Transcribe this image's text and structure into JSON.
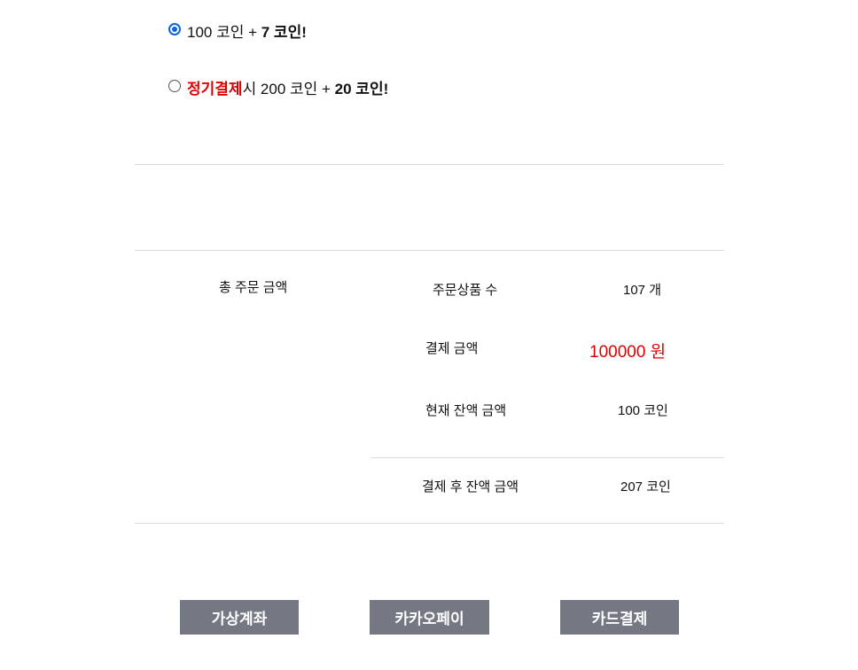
{
  "options": [
    {
      "selected": true,
      "prefix_highlight": "",
      "text": "100 코인 + ",
      "bonus": "7 코인!"
    },
    {
      "selected": false,
      "prefix_highlight": "정기결제",
      "text": "시 200 코인 + ",
      "bonus": "20 코인!"
    }
  ],
  "summary": {
    "section_label": "총 주문 금액",
    "order_count_label": "주문상품 수",
    "order_count_value": "107 개",
    "payment_label": "결제 금액",
    "payment_value": "100000 원",
    "balance_label": "현재 잔액 금액",
    "balance_value": "100 코인",
    "after_label": "결제 후 잔액 금액",
    "after_value": "207 코인"
  },
  "buttons": {
    "virtual_account": "가상계좌",
    "kakaopay": "카카오페이",
    "card": "카드결제"
  },
  "colors": {
    "accent_red": "#e00000",
    "radio_blue": "#0a66d6",
    "button_gray": "#737882"
  }
}
